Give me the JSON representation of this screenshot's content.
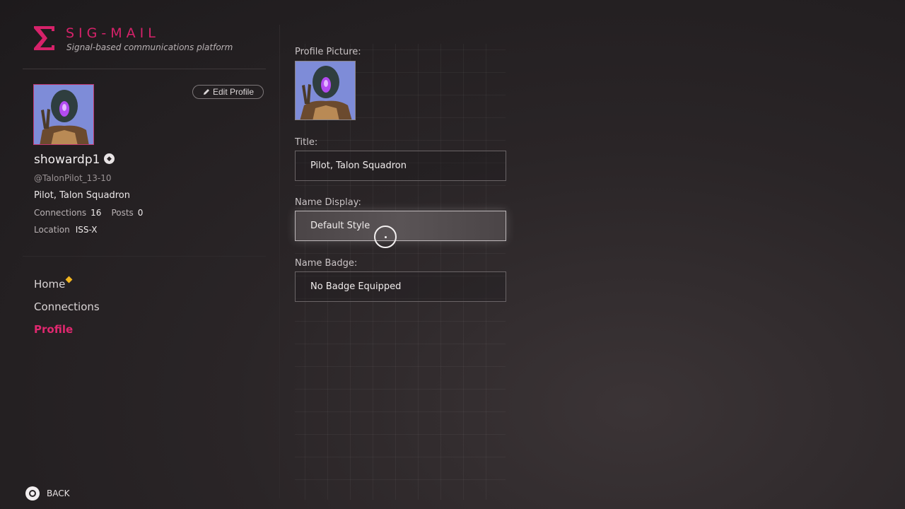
{
  "brand": {
    "title": "SIG-MAIL",
    "subtitle": "Signal-based communications platform",
    "logo_icon": "sigma-icon",
    "accent_color": "#d6226a"
  },
  "profile": {
    "edit_label": "Edit Profile",
    "username": "showardp1",
    "handle": "@TalonPilot_13-10",
    "title": "Pilot, Talon Squadron",
    "connections_label": "Connections",
    "connections_value": "16",
    "posts_label": "Posts",
    "posts_value": "0",
    "location_label": "Location",
    "location_value": "ISS-X"
  },
  "nav": {
    "items": [
      {
        "label": "Home",
        "has_notification": true
      },
      {
        "label": "Connections"
      },
      {
        "label": "Profile",
        "active": true
      }
    ]
  },
  "editor": {
    "picture_label": "Profile Picture:",
    "title_label": "Title:",
    "title_value": "Pilot, Talon Squadron",
    "name_display_label": "Name Display:",
    "name_display_value": "Default Style",
    "badge_label": "Name Badge:",
    "badge_value": "No Badge Equipped"
  },
  "footer": {
    "back_label": "BACK",
    "back_icon": "circle-button-icon"
  }
}
